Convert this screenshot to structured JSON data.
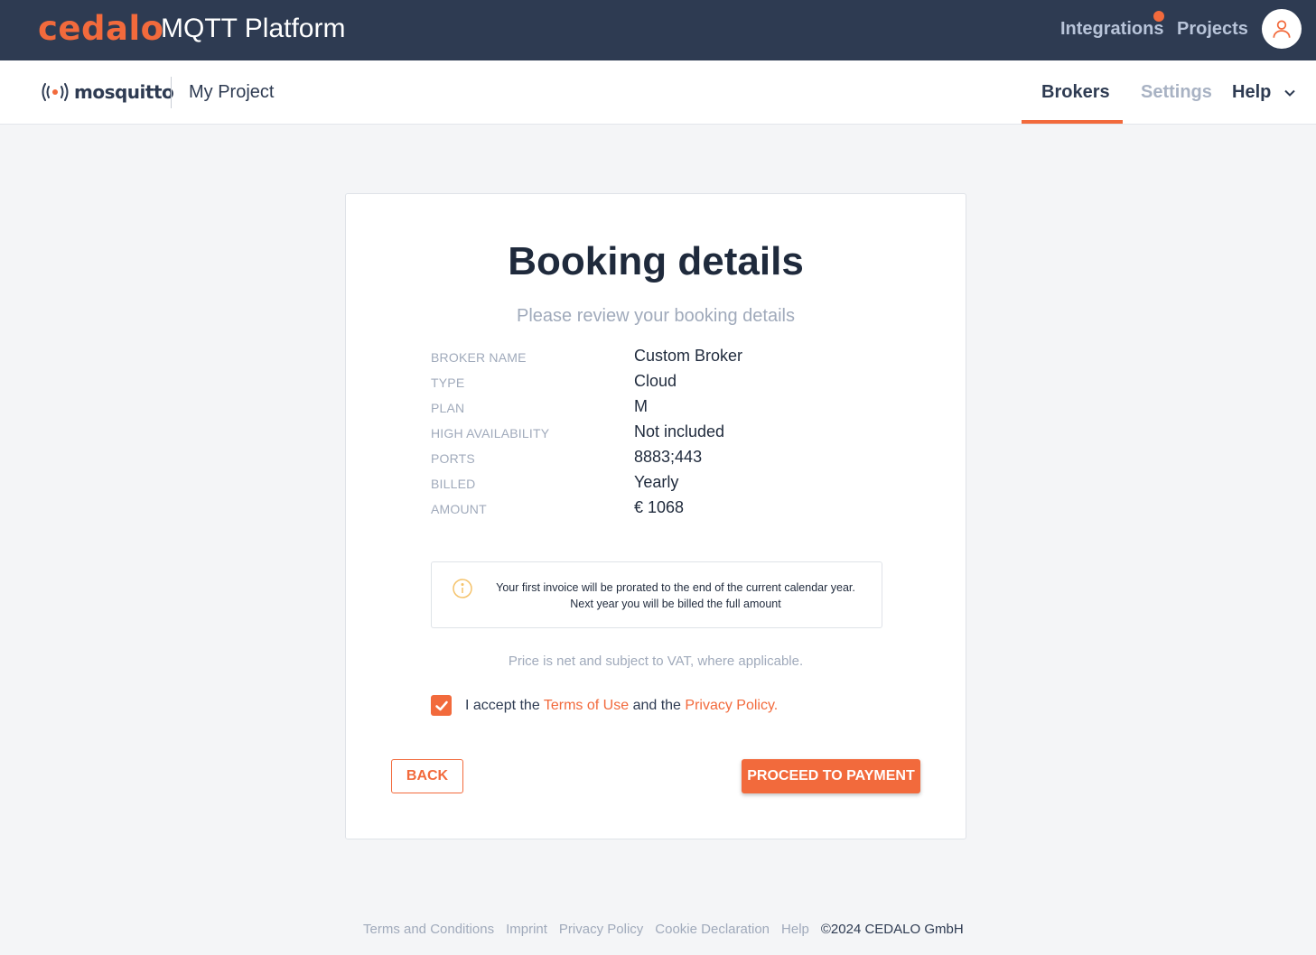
{
  "topbar": {
    "brand": "cedalo",
    "title": "MQTT Platform",
    "nav": [
      "Integrations",
      "Projects"
    ],
    "colors": {
      "background": "#2e3b52",
      "accent": "#f26a3c"
    }
  },
  "subbar": {
    "logo_text": "mosquitto",
    "project": "My Project",
    "tabs": {
      "brokers": "Brokers",
      "settings": "Settings",
      "help": "Help"
    }
  },
  "booking": {
    "title": "Booking details",
    "subtitle": "Please review your booking details",
    "details": [
      {
        "label": "Broker Name",
        "value": "Custom Broker"
      },
      {
        "label": "Type",
        "value": "Cloud"
      },
      {
        "label": "Plan",
        "value": "M"
      },
      {
        "label": "High Availability",
        "value": "Not included"
      },
      {
        "label": "Ports",
        "value": "8883;443"
      },
      {
        "label": "Billed",
        "value": "Yearly"
      },
      {
        "label": "Amount",
        "value": "€ 1068"
      }
    ],
    "info": {
      "line1": "Your first invoice will be prorated to the end of the current calendar year.",
      "line2": "Next year you will be billed the full amount"
    },
    "vat_note": "Price is net and subject to VAT, where applicable.",
    "accept": {
      "prefix": "I accept the ",
      "terms": "Terms of Use",
      "middle": " and the ",
      "privacy": "Privacy Policy.",
      "checked": true
    },
    "buttons": {
      "back": "BACK",
      "proceed": "PROCEED TO PAYMENT"
    }
  },
  "footer": {
    "links": [
      "Terms and Conditions",
      "Imprint",
      "Privacy Policy",
      "Cookie Declaration",
      "Help"
    ],
    "copyright": "©2024 CEDALO GmbH"
  }
}
